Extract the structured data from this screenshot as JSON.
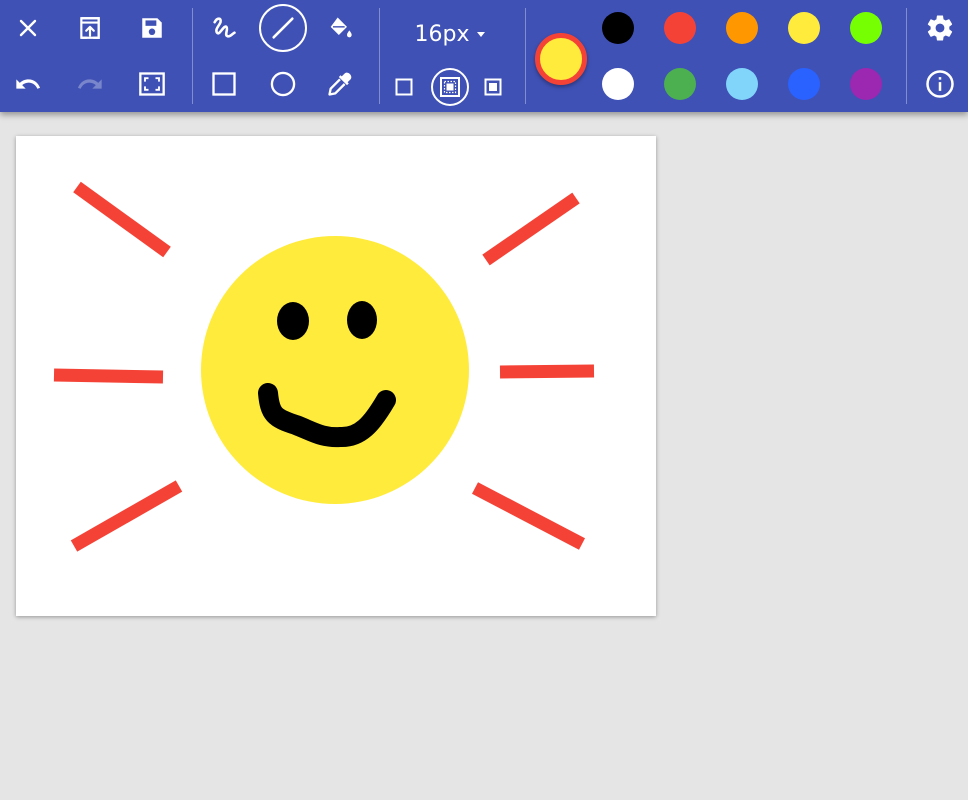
{
  "toolbar": {
    "brush_size": "16px",
    "current_color": "#ffeb3b",
    "current_color_border": "#f44336",
    "background": "#3f51b5"
  },
  "palette": [
    {
      "name": "black",
      "color": "#000000"
    },
    {
      "name": "red",
      "color": "#f44336"
    },
    {
      "name": "orange",
      "color": "#ff9800"
    },
    {
      "name": "yellow",
      "color": "#ffeb3b"
    },
    {
      "name": "lime",
      "color": "#76ff03"
    },
    {
      "name": "white",
      "color": "#ffffff"
    },
    {
      "name": "green",
      "color": "#4caf50"
    },
    {
      "name": "light-blue",
      "color": "#81d4fa"
    },
    {
      "name": "blue",
      "color": "#2962ff"
    },
    {
      "name": "purple",
      "color": "#9c27b0"
    }
  ],
  "icons": {
    "close": "close-icon",
    "open": "open-file-icon",
    "save": "save-icon",
    "undo": "undo-icon",
    "redo": "redo-icon",
    "fit": "fit-screen-icon",
    "freehand": "freehand-icon",
    "line": "line-icon",
    "fill": "fill-bucket-icon",
    "rectangle": "rectangle-icon",
    "ellipse": "ellipse-icon",
    "picker": "eyedropper-icon",
    "settings": "gear-icon",
    "info": "info-icon"
  },
  "drawing": {
    "sun_color": "#ffeb3b",
    "ray_color": "#f44336",
    "face_color": "#000000"
  }
}
